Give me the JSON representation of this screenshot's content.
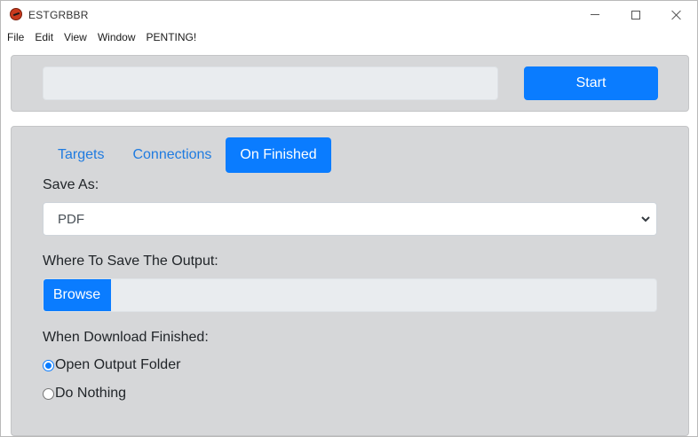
{
  "window": {
    "title": "ESTGRBBR",
    "icon": "app-logo-icon",
    "controls": [
      "minimize-icon",
      "maximize-icon",
      "close-icon"
    ]
  },
  "menu": {
    "items": [
      "File",
      "Edit",
      "View",
      "Window",
      "PENTING!"
    ]
  },
  "toolbar": {
    "url_value": "",
    "start_label": "Start"
  },
  "tabs": [
    {
      "label": "Targets",
      "active": false
    },
    {
      "label": "Connections",
      "active": false
    },
    {
      "label": "On Finished",
      "active": true
    }
  ],
  "on_finished": {
    "save_as_label": "Save As:",
    "save_as_value": "PDF",
    "where_label": "Where To Save The Output:",
    "browse_label": "Browse",
    "output_path": "",
    "when_label": "When Download Finished:",
    "options": [
      {
        "label": "Open Output Folder",
        "checked": true
      },
      {
        "label": "Do Nothing",
        "checked": false
      }
    ]
  },
  "colors": {
    "accent": "#0a7cff",
    "panel": "#d6d7d9",
    "input_bg": "#e9ecef",
    "tab_link": "#1f7be0"
  }
}
